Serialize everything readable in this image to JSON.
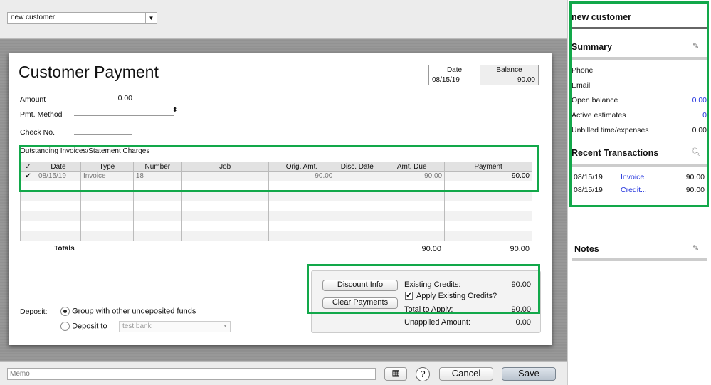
{
  "customer_select": {
    "value": "new customer"
  },
  "form": {
    "title": "Customer Payment",
    "date_label": "Date",
    "balance_label": "Balance",
    "date": "08/15/19",
    "balance": "90.00",
    "amount_label": "Amount",
    "amount": "0.00",
    "pmt_method_label": "Pmt. Method",
    "check_no_label": "Check No.",
    "section_title": "Outstanding Invoices/Statement Charges",
    "columns": [
      "✓",
      "Date",
      "Type",
      "Number",
      "Job",
      "Orig. Amt.",
      "Disc. Date",
      "Amt. Due",
      "Payment"
    ],
    "rows": [
      {
        "check": "✔",
        "date": "08/15/19",
        "type": "Invoice",
        "number": "18",
        "job": "",
        "orig": "90.00",
        "disc_date": "",
        "due": "90.00",
        "payment": "90.00"
      }
    ],
    "totals_label": "Totals",
    "total_due": "90.00",
    "total_payment": "90.00",
    "discount_info": "Discount Info",
    "clear_payments": "Clear Payments",
    "existing_credits_label": "Existing Credits:",
    "existing_credits": "90.00",
    "apply_credits_label": "Apply Existing Credits?",
    "apply_credits_checked": true,
    "total_apply_label": "Total to Apply:",
    "total_apply": "90.00",
    "unapplied_label": "Unapplied Amount:",
    "unapplied": "0.00",
    "deposit_label": "Deposit:",
    "group_label": "Group with other undeposited funds",
    "deposit_to_label": "Deposit to",
    "deposit_account": "test bank"
  },
  "bottom": {
    "memo_placeholder": "Memo",
    "help": "?",
    "cancel": "Cancel",
    "save": "Save"
  },
  "sidebar": {
    "name": "new customer",
    "summary": "Summary",
    "fields": [
      {
        "label": "Phone",
        "value": ""
      },
      {
        "label": "Email",
        "value": ""
      },
      {
        "label": "Open balance",
        "value": "0.00",
        "link": true
      },
      {
        "label": "Active estimates",
        "value": "0",
        "link": true
      },
      {
        "label": "Unbilled time/expenses",
        "value": "0.00"
      }
    ],
    "recent": "Recent Transactions",
    "transactions": [
      {
        "date": "08/15/19",
        "type": "Invoice",
        "amount": "90.00"
      },
      {
        "date": "08/15/19",
        "type": "Credit...",
        "amount": "90.00"
      }
    ],
    "notes": "Notes"
  }
}
